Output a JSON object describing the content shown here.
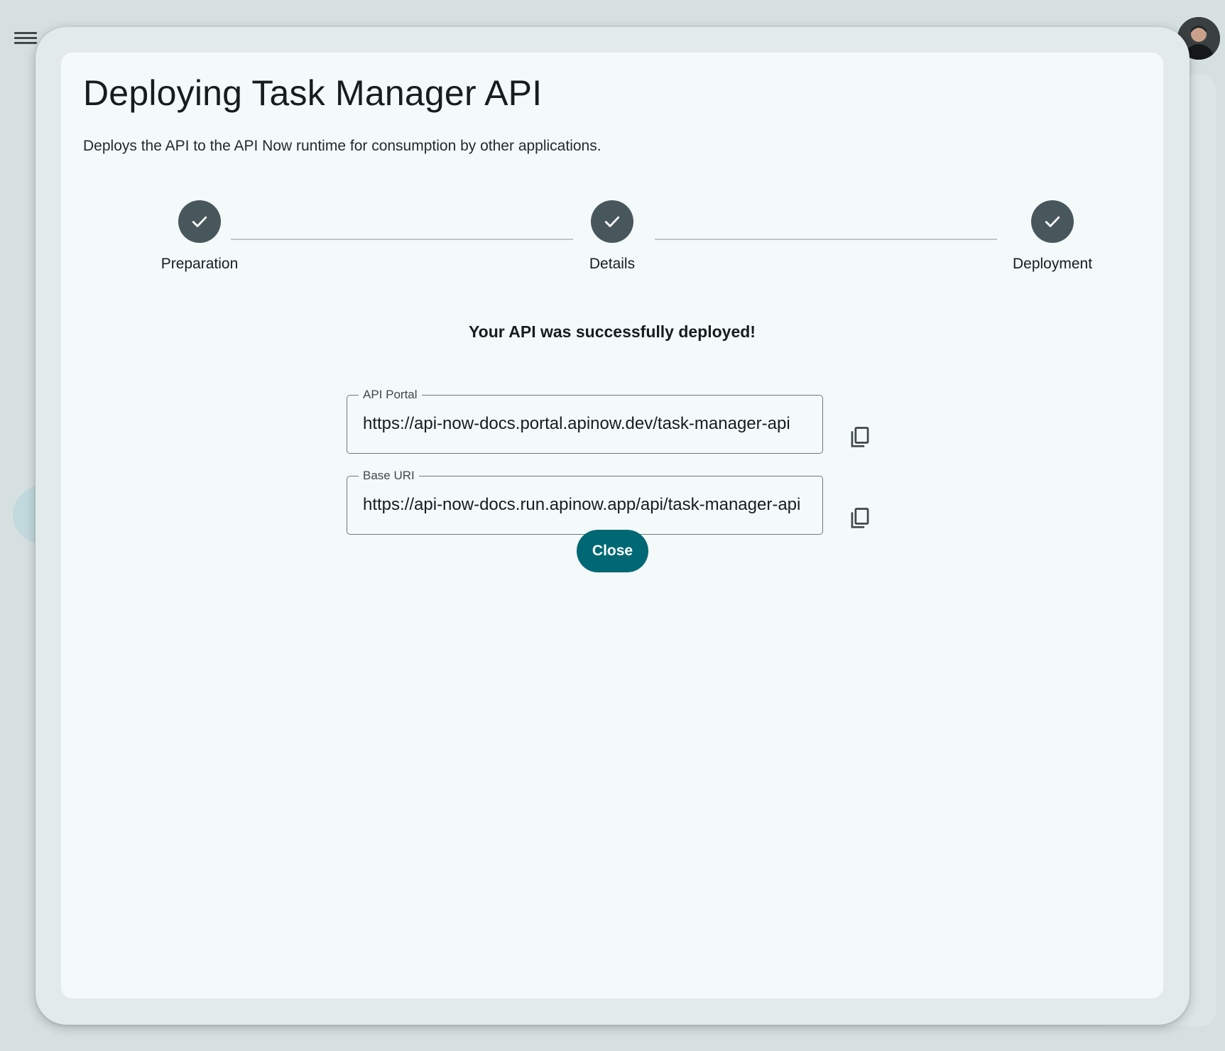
{
  "dialog": {
    "title": "Deploying Task Manager API",
    "description": "Deploys the API to the API Now runtime for consumption by other applications."
  },
  "stepper": {
    "steps": [
      {
        "label": "Preparation",
        "status": "completed",
        "icon": "check-icon"
      },
      {
        "label": "Details",
        "status": "completed",
        "icon": "check-icon"
      },
      {
        "label": "Deployment",
        "status": "completed",
        "icon": "check-icon"
      }
    ]
  },
  "result": {
    "message": "Your API was successfully deployed!",
    "fields": [
      {
        "label": "API Portal",
        "value": "https://api-now-docs.portal.apinow.dev/task-manager-api",
        "copy_icon": "copy-icon"
      },
      {
        "label": "Base URI",
        "value": "https://api-now-docs.run.apinow.app/api/task-manager-api",
        "copy_icon": "copy-icon"
      }
    ]
  },
  "actions": {
    "close_label": "Close"
  },
  "header": {
    "menu_icon": "menu-icon",
    "avatar": "user-avatar"
  },
  "colors": {
    "primary": "#006874",
    "step_complete": "#48575b",
    "surface": "#f4f9f9",
    "dialog_frame": "#e3eaea",
    "background": "#d6e0e0"
  }
}
